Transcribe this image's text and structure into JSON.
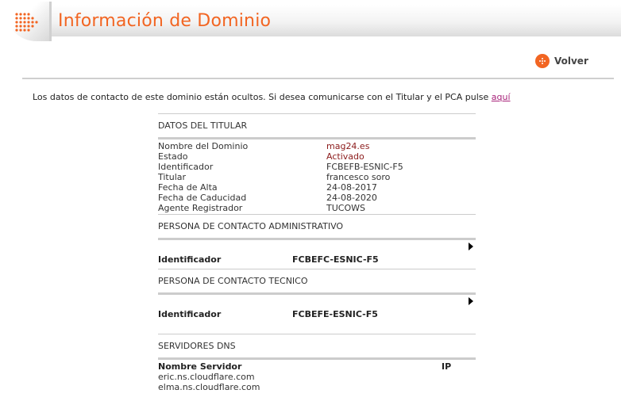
{
  "header": {
    "title": "Información de Dominio"
  },
  "nav": {
    "back_label": "Volver"
  },
  "notice": {
    "text": "Los datos de contacto de este dominio están ocultos. Si desea comunicarse con el Titular y el PCA pulse ",
    "link_label": "aquí"
  },
  "titular": {
    "section_title": "DATOS DEL TITULAR",
    "rows": [
      {
        "key": "Nombre del Dominio",
        "value": "mag24.es"
      },
      {
        "key": "Estado",
        "value": "Activado"
      },
      {
        "key": "Identificador",
        "value": "FCBEFB-ESNIC-F5"
      },
      {
        "key": "Titular",
        "value": "francesco soro"
      },
      {
        "key": "Fecha de Alta",
        "value": "24-08-2017"
      },
      {
        "key": "Fecha de Caducidad",
        "value": "24-08-2020"
      },
      {
        "key": "Agente Registrador",
        "value": "TUCOWS"
      }
    ]
  },
  "admin_contact": {
    "section_title": "PERSONA DE CONTACTO ADMINISTRATIVO",
    "id_label": "Identificador",
    "id_value": "FCBEFC-ESNIC-F5"
  },
  "tech_contact": {
    "section_title": "PERSONA DE CONTACTO TECNICO",
    "id_label": "Identificador",
    "id_value": "FCBEFE-ESNIC-F5"
  },
  "dns": {
    "section_title": "SERVIDORES DNS",
    "col_server": "Nombre Servidor",
    "col_ip": "IP",
    "servers": [
      "eric.ns.cloudflare.com",
      "elma.ns.cloudflare.com"
    ]
  },
  "colors": {
    "accent": "#f26522",
    "link": "#a8237a",
    "value_accent": "#8b1a1a"
  }
}
